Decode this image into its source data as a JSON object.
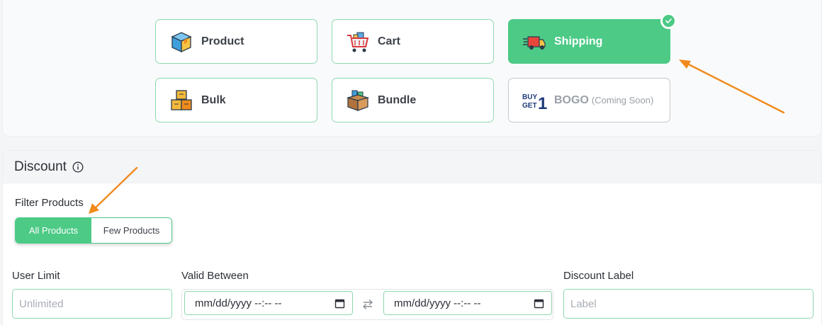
{
  "discount_types": {
    "product": {
      "label": "Product",
      "icon": "box-icon"
    },
    "cart": {
      "label": "Cart",
      "icon": "shopping-cart-icon"
    },
    "shipping": {
      "label": "Shipping",
      "icon": "delivery-truck-icon",
      "selected": true
    },
    "bulk": {
      "label": "Bulk",
      "icon": "stacked-boxes-icon"
    },
    "bundle": {
      "label": "Bundle",
      "icon": "bundle-box-icon"
    },
    "bogo": {
      "label": "BOGO",
      "note": "(Coming Soon)",
      "logo_text": "BUY GET 1",
      "icon": "buy-get-one-icon"
    }
  },
  "discount": {
    "title": "Discount",
    "filter_products": {
      "label": "Filter Products",
      "options": [
        "All Products",
        "Few Products"
      ],
      "selected": "All Products"
    },
    "user_limit": {
      "label": "User Limit",
      "placeholder": "Unlimited",
      "value": ""
    },
    "valid_between": {
      "label": "Valid Between",
      "start": "mm/dd/yyyy --:-- --",
      "end": "mm/dd/yyyy --:-- --"
    },
    "discount_label": {
      "label": "Discount Label",
      "placeholder": "Label",
      "value": ""
    }
  },
  "colors": {
    "accent": "#4cca86",
    "card_border": "#8fd8b1",
    "annotation_arrow": "#f08a1c"
  }
}
